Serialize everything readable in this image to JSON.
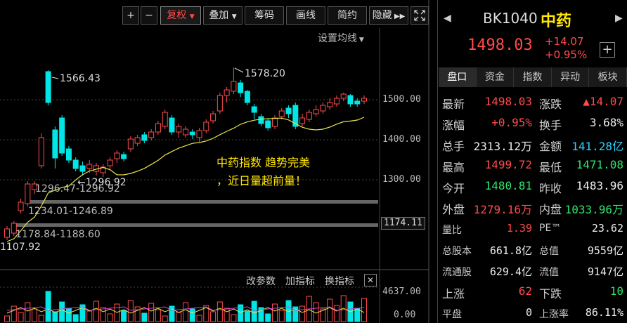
{
  "toolbar": {
    "plus": "+",
    "minus": "−",
    "fuquan": "复权",
    "diejia": "叠加",
    "chouma": "筹码",
    "huaxian": "画线",
    "jianyue": "简约",
    "yincang": "隐藏"
  },
  "chart": {
    "ma_setting": "设置均线",
    "price_axis": [
      "1500.00",
      "1400.00",
      "1300.00"
    ],
    "current_tag": "1174.11",
    "peak1": "1566.43",
    "peak2": "1578.20",
    "low_mark": "1296.92",
    "gap1": "1296.47-1296.92",
    "gap2": "1234.01-1246.89",
    "gap3": "1178.84-1188.60",
    "bottom_low": "1107.92",
    "annotation_line1": "中药指数 趋势完美",
    "annotation_line2": "，近日量超前量！",
    "vol_tools": [
      "改参数",
      "加指标",
      "换指标"
    ],
    "vol_axis_top": "4637.00",
    "vol_axis_bottom": "0.00",
    "colors": {
      "up": "#ff4b4b",
      "down": "#00e5e5",
      "ma": "#e6e64a",
      "annotation": "#ffe600"
    }
  },
  "quote": {
    "code": "BK1040",
    "name": "中药",
    "price": "1498.03",
    "change": "+14.07",
    "change_pct": "+0.95%",
    "tabs": [
      "盘口",
      "资金",
      "指数",
      "异动",
      "板块"
    ],
    "rows": [
      {
        "k": "最新",
        "v": "1498.03",
        "vc": "red",
        "k2": "涨跌",
        "v2": "▲14.07",
        "v2c": "red"
      },
      {
        "k": "涨幅",
        "v": "+0.95%",
        "vc": "red",
        "k2": "换手",
        "v2": "3.68%",
        "v2c": "wht"
      },
      {
        "k": "总手",
        "v": "2313.12万",
        "vc": "wht",
        "k2": "金额",
        "v2": "141.28亿",
        "v2c": "cyan"
      },
      {
        "k": "最高",
        "v": "1499.72",
        "vc": "red",
        "k2": "最低",
        "v2": "1471.08",
        "v2c": "green"
      },
      {
        "k": "今开",
        "v": "1480.81",
        "vc": "green",
        "k2": "昨收",
        "v2": "1483.96",
        "v2c": "wht"
      },
      {
        "k": "外盘",
        "v": "1279.16万",
        "vc": "red",
        "k2": "内盘",
        "v2": "1033.96万",
        "v2c": "green"
      },
      {
        "k": "量比",
        "v": "1.39",
        "vc": "red",
        "k2": "PE™",
        "v2": "23.62",
        "v2c": "wht"
      },
      {
        "k": "总股本",
        "v": "661.8亿",
        "vc": "wht",
        "k2": "总值",
        "v2": "9559亿",
        "v2c": "wht"
      },
      {
        "k": "流通股",
        "v": "629.4亿",
        "vc": "wht",
        "k2": "流值",
        "v2": "9147亿",
        "v2c": "wht"
      },
      {
        "k": "上涨",
        "v": "62",
        "vc": "red",
        "k2": "下跌",
        "v2": "10",
        "v2c": "green"
      },
      {
        "k": "平盘",
        "v": "0",
        "vc": "wht",
        "k2": "上涨率",
        "v2": "86.11%",
        "v2c": "wht"
      }
    ]
  }
}
